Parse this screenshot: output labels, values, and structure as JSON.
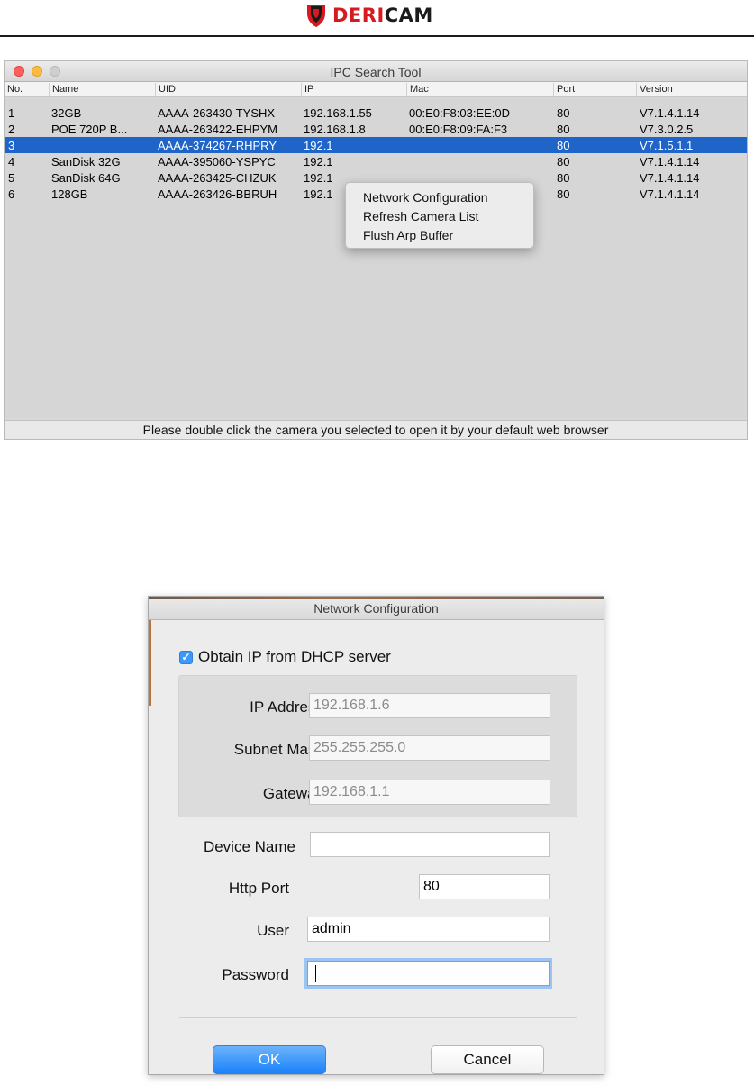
{
  "brand": {
    "prefix": "DERI",
    "suffix": "CAM"
  },
  "search_window": {
    "title": "IPC Search Tool",
    "columns": [
      "No.",
      "Name",
      "UID",
      "IP",
      "Mac",
      "Port",
      "Version"
    ],
    "rows": [
      {
        "no": "1",
        "name": "32GB",
        "uid": "AAAA-263430-TYSHX",
        "ip": "192.168.1.55",
        "mac": "00:E0:F8:03:EE:0D",
        "port": "80",
        "version": "V7.1.4.1.14"
      },
      {
        "no": "2",
        "name": "POE 720P B...",
        "uid": "AAAA-263422-EHPYM",
        "ip": "192.168.1.8",
        "mac": "00:E0:F8:09:FA:F3",
        "port": "80",
        "version": "V7.3.0.2.5"
      },
      {
        "no": "3",
        "name": "",
        "uid": "AAAA-374267-RHPRY",
        "ip": "192.1",
        "mac": "",
        "port": "80",
        "version": "V7.1.5.1.1"
      },
      {
        "no": "4",
        "name": "SanDisk 32G",
        "uid": "AAAA-395060-YSPYC",
        "ip": "192.1",
        "mac": "",
        "port": "80",
        "version": "V7.1.4.1.14"
      },
      {
        "no": "5",
        "name": "SanDisk 64G",
        "uid": "AAAA-263425-CHZUK",
        "ip": "192.1",
        "mac": "",
        "port": "80",
        "version": "V7.1.4.1.14"
      },
      {
        "no": "6",
        "name": "128GB",
        "uid": "AAAA-263426-BBRUH",
        "ip": "192.1",
        "mac": "",
        "port": "80",
        "version": "V7.1.4.1.14"
      }
    ],
    "selected_row": "3",
    "context_menu": [
      "Network Configuration",
      "Refresh Camera List",
      "Flush Arp Buffer"
    ],
    "status": "Please double click the camera you selected to open it by your default web browser"
  },
  "network_dialog": {
    "title": "Network Configuration",
    "dhcp_label": "Obtain IP from DHCP server",
    "dhcp_checked": true,
    "ip_address_label": "IP Address",
    "ip_address_value": "192.168.1.6",
    "subnet_mask_label": "Subnet Mask",
    "subnet_mask_value": "255.255.255.0",
    "gateway_label": "Gateway",
    "gateway_value": "192.168.1.1",
    "device_name_label": "Device Name",
    "device_name_value": "",
    "http_port_label": "Http Port",
    "http_port_value": "80",
    "user_label": "User",
    "user_value": "admin",
    "password_label": "Password",
    "password_value": "",
    "ok_label": "OK",
    "cancel_label": "Cancel"
  },
  "colors": {
    "brand_red": "#d71920",
    "selection_blue": "#1f64c9",
    "checkbox_blue": "#3b99fc",
    "ok_button_blue": "#1a82fb"
  },
  "icons": {
    "brand_logo": "shield-icon",
    "checkbox": "checkmark-icon"
  }
}
